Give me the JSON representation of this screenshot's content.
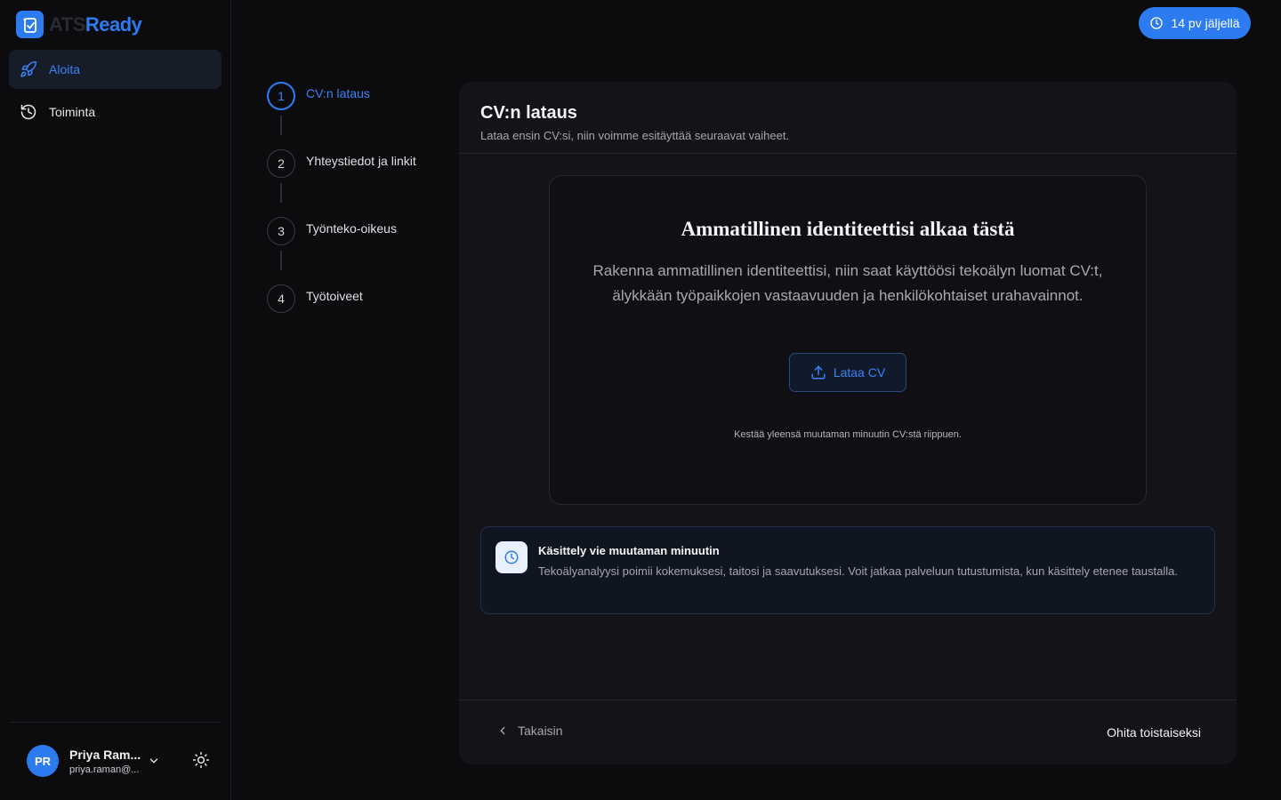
{
  "brand": {
    "name_part1": "ATS",
    "name_part2": "Ready",
    "accent": "#2d7bf0"
  },
  "sidebar": {
    "items": [
      {
        "label": "Aloita",
        "icon": "rocket-icon",
        "active": true
      },
      {
        "label": "Toiminta",
        "icon": "history-icon",
        "active": false
      }
    ],
    "user": {
      "initials": "PR",
      "name": "Priya Ram...",
      "email": "priya.raman@..."
    }
  },
  "trial": {
    "label": "14 pv jäljellä"
  },
  "stepper": {
    "steps": [
      {
        "number": "1",
        "label": "CV:n lataus",
        "active": true
      },
      {
        "number": "2",
        "label": "Yhteystiedot ja linkit",
        "active": false
      },
      {
        "number": "3",
        "label": "Työnteko-oikeus",
        "active": false
      },
      {
        "number": "4",
        "label": "Työtoiveet",
        "active": false
      }
    ]
  },
  "panel": {
    "title": "CV:n lataus",
    "subtitle": "Lataa ensin CV:si, niin voimme esitäyttää seuraavat vaiheet.",
    "upload": {
      "heading": "Ammatillinen identiteettisi alkaa tästä",
      "description": "Rakenna ammatillinen identiteettisi, niin saat käyttöösi tekoälyn luomat CV:t, älykkään työpaikkojen vastaavuuden ja henkilökohtaiset urahavainnot.",
      "button": "Lataa CV",
      "note": "Kestää yleensä muutaman minuutin CV:stä riippuen."
    },
    "info": {
      "title": "Käsittely vie muutaman minuutin",
      "text": "Tekoälyanalyysi poimii kokemuksesi, taitosi ja saavutuksesi. Voit jatkaa palveluun tutustumista, kun käsittely etenee taustalla."
    },
    "footer": {
      "back": "Takaisin",
      "skip": "Ohita toistaiseksi"
    }
  }
}
